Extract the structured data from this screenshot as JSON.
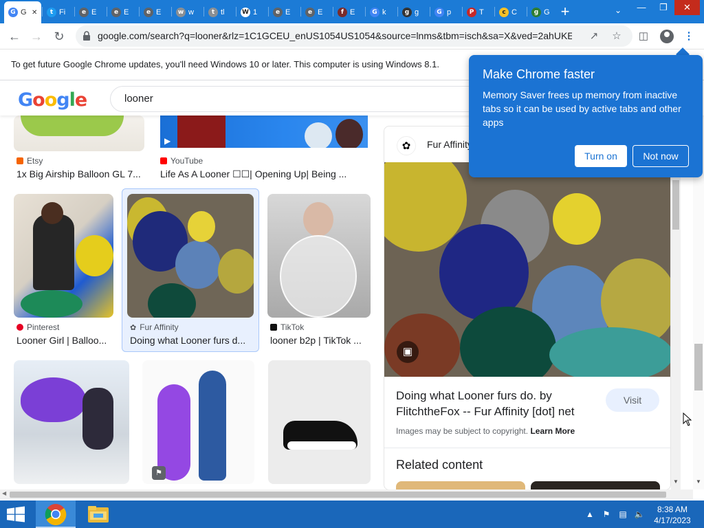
{
  "tabs": [
    {
      "letter": "G",
      "label": "G",
      "color": "#4285f4",
      "active": true
    },
    {
      "letter": "t",
      "label": "Fi",
      "color": "#1d9bf0"
    },
    {
      "letter": "e",
      "label": "E",
      "color": "#5f6368"
    },
    {
      "letter": "e",
      "label": "E",
      "color": "#5f6368"
    },
    {
      "letter": "e",
      "label": "E",
      "color": "#5f6368"
    },
    {
      "letter": "w",
      "label": "w",
      "color": "#8a8f94"
    },
    {
      "letter": "t",
      "label": "tl",
      "color": "#8a8f94"
    },
    {
      "letter": "W",
      "label": "1",
      "color": "#ffffff"
    },
    {
      "letter": "e",
      "label": "E",
      "color": "#5f6368"
    },
    {
      "letter": "e",
      "label": "E",
      "color": "#5f6368"
    },
    {
      "letter": "f",
      "label": "E",
      "color": "#7a2b2b"
    },
    {
      "letter": "G",
      "label": "k",
      "color": "#4285f4"
    },
    {
      "letter": "g",
      "label": "g",
      "color": "#333333"
    },
    {
      "letter": "G",
      "label": "p",
      "color": "#4285f4"
    },
    {
      "letter": "P",
      "label": "T",
      "color": "#c62828"
    },
    {
      "letter": "c",
      "label": "C",
      "color": "#f6c026"
    },
    {
      "letter": "g",
      "label": "G",
      "color": "#2e7d32"
    }
  ],
  "omnibox": {
    "url": "google.com/search?q=looner&rlz=1C1GCEU_enUS1054US1054&source=lnms&tbm=isch&sa=X&ved=2ahUKEw..."
  },
  "infobar": {
    "text": "To get future Google Chrome updates, you'll need Windows 10 or later. This computer is using Windows 8.1."
  },
  "google": {
    "logo": [
      "G",
      "o",
      "o",
      "g",
      "l",
      "e"
    ],
    "query": "looner"
  },
  "results": {
    "row1": [
      {
        "source": "Etsy",
        "title": "1x Big Airship Balloon GL 7...",
        "src_color": "#f56400"
      },
      {
        "source": "YouTube",
        "title": "Life As A Looner ☐☐| Opening Up| Being ...",
        "src_color": "#ff0000"
      }
    ],
    "row2": [
      {
        "source": "Pinterest",
        "title": "Looner Girl | Balloo...",
        "src_color": "#e60023"
      },
      {
        "source": "Fur Affinity",
        "title": "Doing what Looner furs d...",
        "src_color": "#333333"
      },
      {
        "source": "TikTok",
        "title": "looner b2p | TikTok ...",
        "src_color": "#111111"
      }
    ]
  },
  "panel": {
    "source": "Fur Affinity",
    "title": "Doing what Looner furs do. by FlitchtheFox -- Fur Affinity [dot] net",
    "visit_label": "Visit",
    "copyright": "Images may be subject to copyright.",
    "learn_more": "Learn More",
    "related": "Related content"
  },
  "popup": {
    "title": "Make Chrome faster",
    "body": "Memory Saver frees up memory from inactive tabs so it can be used by active tabs and other apps",
    "turn_on": "Turn on",
    "not_now": "Not now"
  },
  "taskbar": {
    "time": "8:38 AM",
    "date": "4/17/2023"
  },
  "colors": {
    "tabstrip": "#1c7bd6",
    "popup": "#1b73d3",
    "taskbar": "#1a67ba"
  }
}
